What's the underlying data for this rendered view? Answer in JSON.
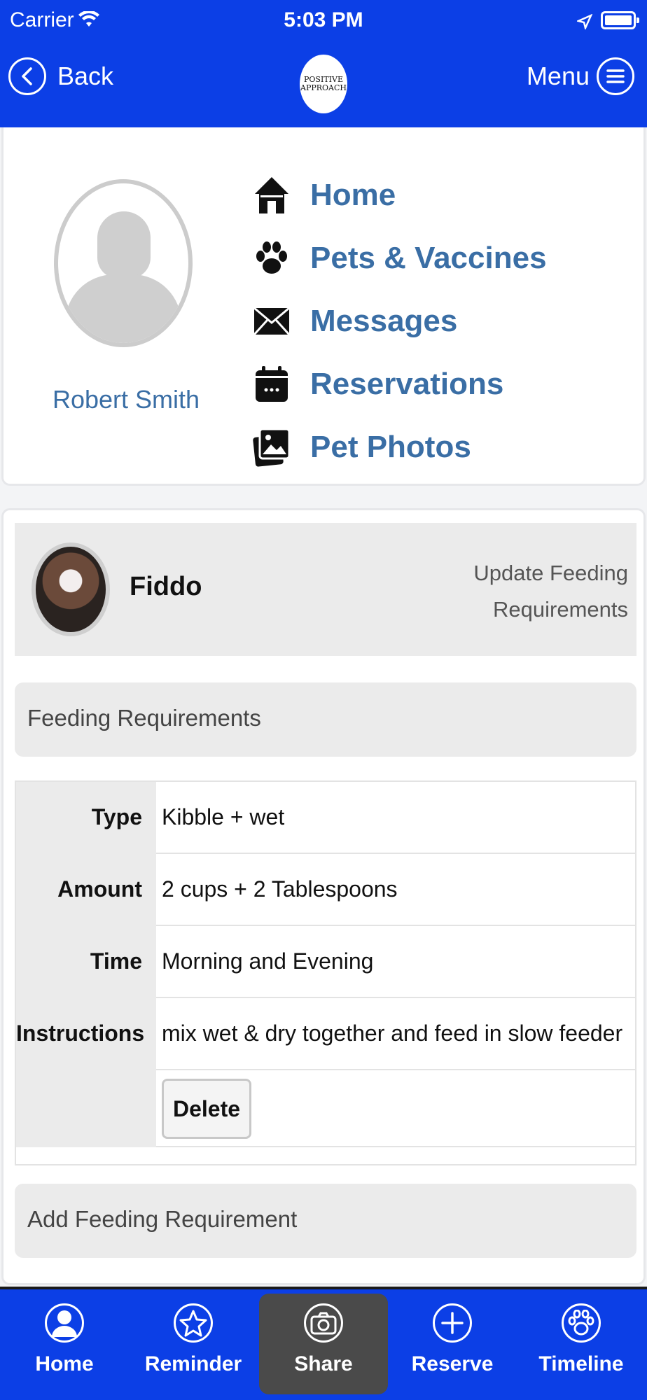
{
  "status_bar": {
    "carrier": "Carrier",
    "time": "5:03 PM"
  },
  "header": {
    "back_label": "Back",
    "menu_label": "Menu",
    "logo_text": "POSITIVE APPROACH"
  },
  "profile": {
    "name": "Robert Smith"
  },
  "nav": {
    "items": [
      {
        "label": "Home",
        "icon": "house-icon"
      },
      {
        "label": "Pets & Vaccines",
        "icon": "paw-icon"
      },
      {
        "label": "Messages",
        "icon": "envelope-icon"
      },
      {
        "label": "Reservations",
        "icon": "calendar-icon"
      },
      {
        "label": "Pet Photos",
        "icon": "photos-icon"
      }
    ]
  },
  "pet": {
    "name": "Fiddo",
    "update_link_line1": "Update Feeding",
    "update_link_line2": "Requirements"
  },
  "feeding": {
    "section_title": "Feeding Requirements",
    "rows": [
      {
        "label": "Type",
        "value": "Kibble + wet"
      },
      {
        "label": "Amount",
        "value": "2 cups + 2 Tablespoons"
      },
      {
        "label": "Time",
        "value": "Morning and Evening"
      },
      {
        "label": "Instructions",
        "value": "mix wet & dry together and feed in slow feeder"
      }
    ],
    "delete_label": "Delete",
    "add_label": "Add Feeding Requirement"
  },
  "tabbar": {
    "tabs": [
      {
        "label": "Home",
        "icon": "person-icon"
      },
      {
        "label": "Reminder",
        "icon": "star-icon"
      },
      {
        "label": "Share",
        "icon": "camera-icon",
        "active": true
      },
      {
        "label": "Reserve",
        "icon": "plus-icon"
      },
      {
        "label": "Timeline",
        "icon": "paw-icon"
      }
    ]
  },
  "colors": {
    "brand_blue": "#0c3fe6",
    "link_blue": "#3a6ea5",
    "active_tab": "#4a4a4a"
  }
}
